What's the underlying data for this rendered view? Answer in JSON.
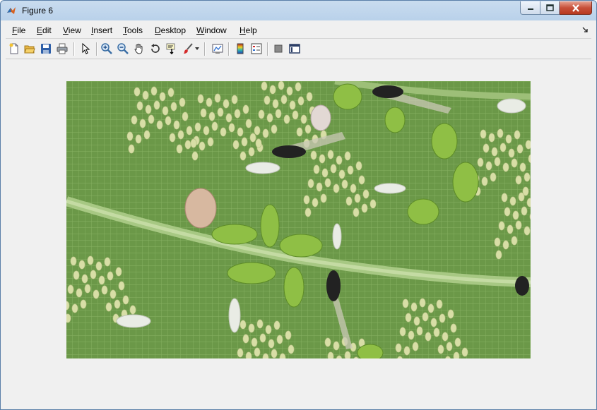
{
  "window": {
    "title": "Figure 6",
    "controls": {
      "minimize": "minimize",
      "maximize": "maximize",
      "close": "close"
    }
  },
  "menubar": {
    "items": [
      {
        "mnemonic": "F",
        "rest": "ile"
      },
      {
        "mnemonic": "E",
        "rest": "dit"
      },
      {
        "mnemonic": "V",
        "rest": "iew"
      },
      {
        "mnemonic": "I",
        "rest": "nsert"
      },
      {
        "mnemonic": "T",
        "rest": "ools"
      },
      {
        "mnemonic": "D",
        "rest": "esktop"
      },
      {
        "mnemonic": "W",
        "rest": "indow"
      },
      {
        "mnemonic": "H",
        "rest": "elp"
      }
    ]
  },
  "toolbar": {
    "icons": [
      "new-figure-icon",
      "open-file-icon",
      "save-figure-icon",
      "print-figure-icon",
      "edit-plot-arrow-icon",
      "zoom-in-icon",
      "zoom-out-icon",
      "pan-hand-icon",
      "rotate-3d-icon",
      "data-cursor-icon",
      "brush-icon",
      "brush-dropdown-icon",
      "link-plot-icon",
      "insert-colorbar-icon",
      "insert-legend-icon",
      "hide-plot-tools-icon",
      "show-plot-tools-icon"
    ]
  },
  "figure": {
    "image_subject": "photograph",
    "colors": {
      "leaf": "#6e9a4c",
      "vein": "#9ec07a",
      "eggs": "#d6dca4",
      "aphid": "#8fbf45"
    }
  }
}
